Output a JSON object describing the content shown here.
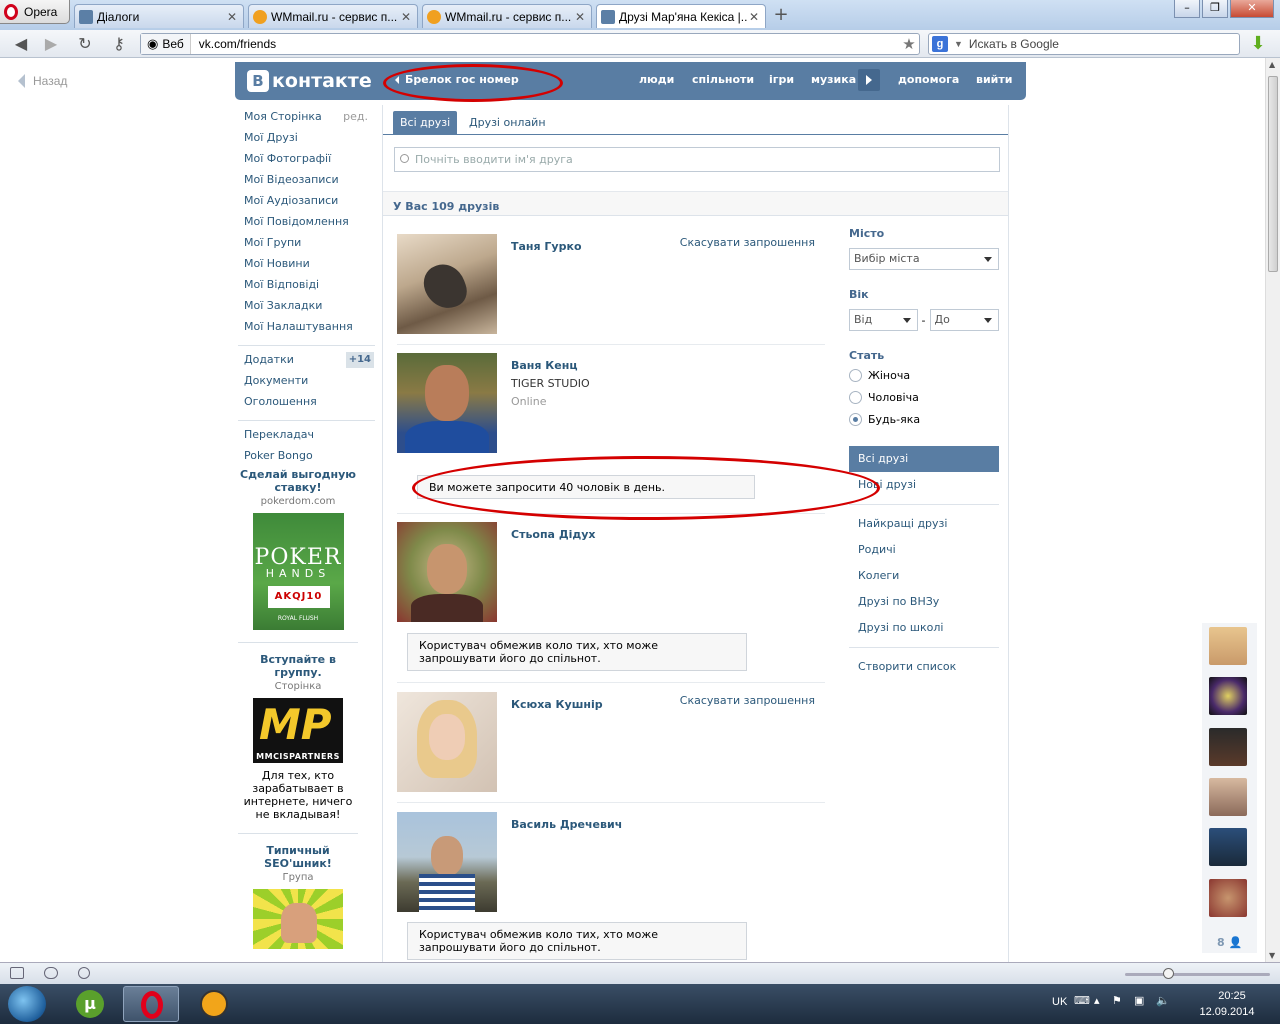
{
  "browser": {
    "menu_label": "Opera",
    "tabs": [
      {
        "label": "Діалоги"
      },
      {
        "label": "WMmail.ru - сервис п..."
      },
      {
        "label": "WMmail.ru - сервис п..."
      },
      {
        "label": "Друзі Мар'яна Кекіса |..."
      }
    ],
    "address_scheme_label": "Веб",
    "url": "vk.com/friends",
    "search_placeholder": "Искать в Google"
  },
  "page": {
    "back_label": "Назад",
    "header": {
      "logo": "контакте",
      "logo_badge": "В",
      "back_link": "Брелок гос номер",
      "nav": [
        "люди",
        "спільноти",
        "ігри",
        "музика",
        "допомога",
        "вийти"
      ]
    },
    "left_menu": {
      "items": [
        "Моя Сторінка",
        "Мої Друзі",
        "Мої Фотографії",
        "Мої Відеозаписи",
        "Мої Аудіозаписи",
        "Мої Повідомлення",
        "Мої Групи",
        "Мої Новини",
        "Мої Відповіді",
        "Мої Закладки",
        "Мої Налаштування"
      ],
      "edit_label": "ред.",
      "apps": [
        "Додатки",
        "Документи",
        "Оголошення"
      ],
      "apps_badge": "+14",
      "extra": [
        "Перекладач",
        "Poker Bongo"
      ]
    },
    "ads": [
      {
        "title": "Сделай выгодную ставку!",
        "sub": "pokerdom.com",
        "img_line1": "POKER",
        "img_line2": "HANDS",
        "img_cards": "AKQJ10",
        "img_line3": "ROYAL FLUSH"
      },
      {
        "title": "Вступайте в группу.",
        "sub": "Сторінка",
        "img_line1": "MP",
        "img_line2": "MMCISPARTNERS",
        "text": "Для тех, кто зарабатывает в интернете, ничего не вкладывая!"
      },
      {
        "title": "Типичный SEO'шник!",
        "sub": "Група"
      }
    ],
    "main": {
      "tabs": [
        "Всі друзі",
        "Друзі онлайн"
      ],
      "search_placeholder": "Почніть вводити ім'я друга",
      "count_label": "У Вас 109 друзів",
      "friends": [
        {
          "name": "Таня Гурко",
          "action": "Скасувати запрошення"
        },
        {
          "name": "Ваня Кенц",
          "sub": "TIGER STUDIO",
          "status": "Online",
          "note": "Ви можете запросити 40 чоловік в день."
        },
        {
          "name": "Стьопа Дідух",
          "note": "Користувач обмежив коло тих, хто може запрошувати його до спільнот."
        },
        {
          "name": "Ксюха Кушнір",
          "action": "Скасувати запрошення"
        },
        {
          "name": "Василь Дречевич",
          "note": "Користувач обмежив коло тих, хто може запрошувати його до спільнот."
        }
      ]
    },
    "filter": {
      "city_label": "Місто",
      "city_value": "Вибір міста",
      "age_label": "Вік",
      "age_from": "Від",
      "age_dash": "-",
      "age_to": "До",
      "gender_label": "Стать",
      "genders": [
        "Жіноча",
        "Чоловіча",
        "Будь-яка"
      ],
      "lists": [
        "Всі друзі",
        "Нові друзі"
      ],
      "lists2": [
        "Найкращі друзі",
        "Родичі",
        "Колеги",
        "Друзі по ВНЗу",
        "Друзі по школі"
      ],
      "create_list": "Створити список"
    },
    "side_online_count": "8"
  },
  "taskbar": {
    "lang": "UK",
    "time": "20:25",
    "date": "12.09.2014"
  },
  "colors": {
    "vk_blue": "#597da3",
    "link": "#2b587a",
    "annotation_red": "#d40000"
  }
}
